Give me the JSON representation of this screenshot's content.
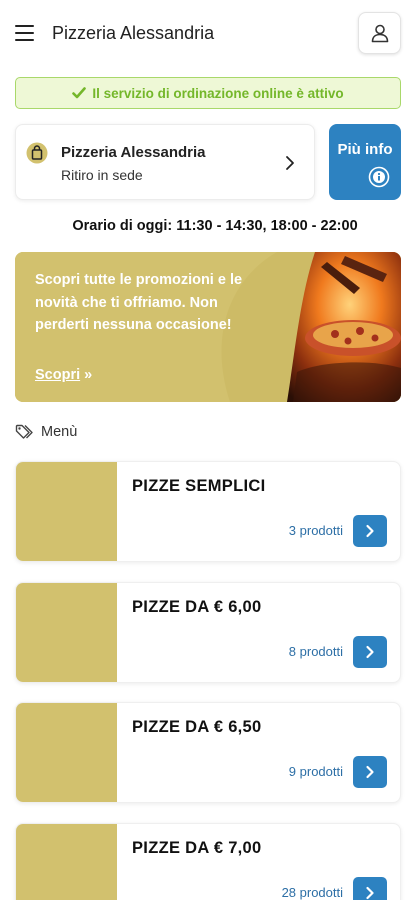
{
  "header": {
    "title": "Pizzeria Alessandria"
  },
  "status": {
    "message": "Il servizio di ordinazione online è attivo"
  },
  "store": {
    "name": "Pizzeria Alessandria",
    "mode": "Ritiro in sede",
    "info_label": "Più info"
  },
  "hours": {
    "text": "Orario di oggi: 11:30 - 14:30, 18:00 - 22:00"
  },
  "promo": {
    "text": "Scopri tutte le promozioni e le novità che ti offriamo. Non perderti nessuna occasione!",
    "link_label": "Scopri",
    "link_arrow": "»"
  },
  "menu": {
    "section_label": "Menù",
    "categories": [
      {
        "name": "PIZZE SEMPLICI",
        "count": "3 prodotti"
      },
      {
        "name": "PIZZE DA € 6,00",
        "count": "8 prodotti"
      },
      {
        "name": "PIZZE DA € 6,50",
        "count": "9 prodotti"
      },
      {
        "name": "PIZZE DA € 7,00",
        "count": "28 prodotti"
      }
    ]
  },
  "colors": {
    "accent_blue": "#2d82c1",
    "status_green": "#74b72a",
    "placeholder_gold": "#d2c16e"
  },
  "icons": {
    "menu": "hamburger-icon",
    "user": "user-icon",
    "status": "check-icon",
    "store": "shopping-bag-icon",
    "store_chevron": "chevron-right-icon",
    "info": "info-circle-icon",
    "promo_link": "double-chevron-right-icon",
    "section": "tags-icon",
    "category_go": "chevron-right-icon"
  }
}
